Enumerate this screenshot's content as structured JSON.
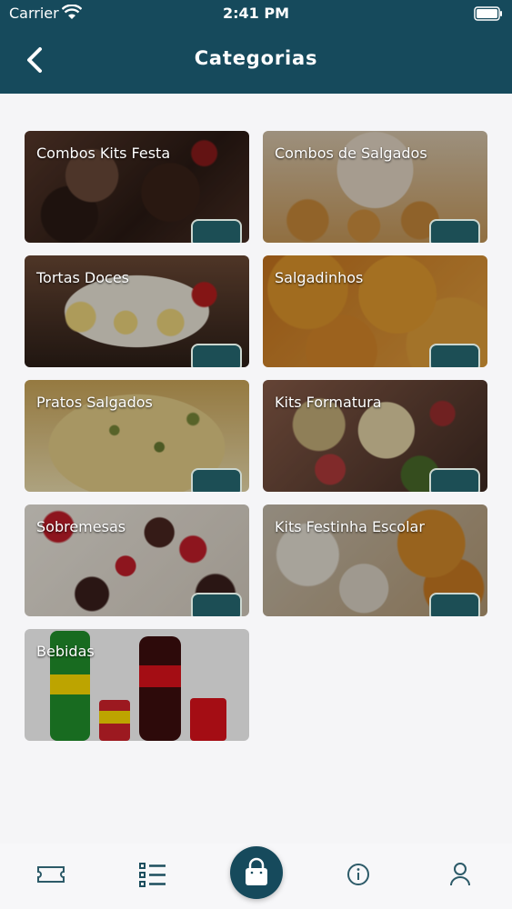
{
  "status_bar": {
    "carrier": "Carrier",
    "time": "2:41 PM"
  },
  "header": {
    "title": "Categorias"
  },
  "categories": [
    {
      "label": "Combos Kits Festa"
    },
    {
      "label": "Combos de Salgados"
    },
    {
      "label": "Tortas Doces"
    },
    {
      "label": "Salgadinhos"
    },
    {
      "label": "Pratos Salgados"
    },
    {
      "label": "Kits Formatura"
    },
    {
      "label": "Sobremesas"
    },
    {
      "label": "Kits Festinha Escolar"
    },
    {
      "label": "Bebidas"
    }
  ],
  "tabbar": {
    "tabs": [
      "ticket-icon",
      "list-icon",
      "shopping-bag-icon",
      "info-icon",
      "user-icon"
    ]
  },
  "colors": {
    "primary": "#164a5c",
    "background": "#f5f5f7",
    "tab_icon": "#2c5a68"
  }
}
